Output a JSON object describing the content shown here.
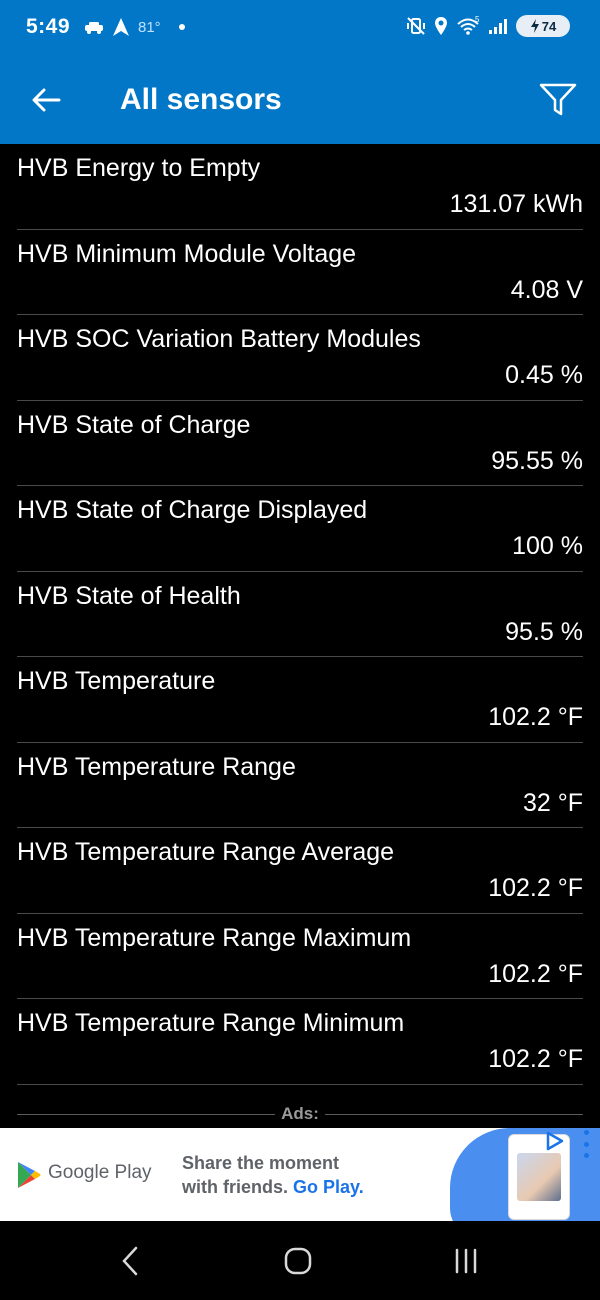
{
  "status_bar": {
    "time": "5:49",
    "temperature": "81°",
    "signal_label": "5",
    "battery": "74",
    "icons": [
      "car-icon",
      "navigation-arrow-icon",
      "notification-dot-icon",
      "vibrate-mute-icon",
      "location-icon",
      "wifi-icon",
      "cell-signal-icon",
      "battery-charging-icon"
    ]
  },
  "app_bar": {
    "title": "All sensors",
    "back_icon": "arrow-left-icon",
    "filter_icon": "filter-icon",
    "color": "#0277c8"
  },
  "sensors": [
    {
      "name": "HVB Energy to Empty",
      "value": "131.07 kWh"
    },
    {
      "name": "HVB Minimum Module Voltage",
      "value": "4.08 V"
    },
    {
      "name": "HVB SOC Variation Battery Modules",
      "value": "0.45 %"
    },
    {
      "name": "HVB State of Charge",
      "value": "95.55 %"
    },
    {
      "name": "HVB State of Charge Displayed",
      "value": "100 %"
    },
    {
      "name": "HVB State of Health",
      "value": "95.5 %"
    },
    {
      "name": "HVB Temperature",
      "value": "102.2 °F"
    },
    {
      "name": "HVB Temperature Range",
      "value": "32 °F"
    },
    {
      "name": "HVB Temperature Range Average",
      "value": "102.2 °F"
    },
    {
      "name": "HVB Temperature Range Maximum",
      "value": "102.2 °F"
    },
    {
      "name": "HVB Temperature Range Minimum",
      "value": "102.2 °F"
    }
  ],
  "ads": {
    "label": "Ads:",
    "brand": "Google Play",
    "headline_line1": "Share the moment",
    "headline_line2_plain": "with friends.",
    "headline_line2_link": "Go Play."
  },
  "nav_bar": {
    "icons": [
      "nav-back-icon",
      "nav-home-icon",
      "nav-recents-icon"
    ]
  }
}
